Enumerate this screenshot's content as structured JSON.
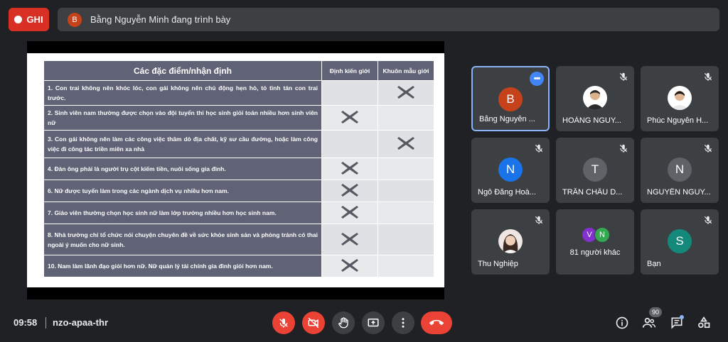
{
  "top_bar": {
    "record_label": "GHI",
    "presenter_initial": "B",
    "presenting_text": "Bằng Nguyễn Minh đang trình bày"
  },
  "slide": {
    "headers": [
      "Các đặc điểm/nhận định",
      "Định kiến giới",
      "Khuôn mẫu giới"
    ],
    "rows": [
      {
        "text": "1. Con trai không nên khóc lóc, con gái không nên chủ động hẹn hò, tỏ tình tán con trai trước.",
        "dinh_kien": false,
        "khuon_mau": true
      },
      {
        "text": "2. Sinh viên nam thường được chọn vào đội tuyển thi học sinh giỏi toán nhiều hơn sinh viên nữ",
        "dinh_kien": true,
        "khuon_mau": false
      },
      {
        "text": "3. Con gái không nên làm các công việc thăm dò địa chất, kỹ sư cầu đường, hoặc làm công việc đi công tác triền miên xa nhà",
        "dinh_kien": false,
        "khuon_mau": true
      },
      {
        "text": "4. Đàn ông phải là người trụ cột kiếm tiền, nuôi sống gia đình.",
        "dinh_kien": true,
        "khuon_mau": false
      },
      {
        "text": "6. Nữ được tuyển làm trong các ngành dịch vụ nhiều hơn nam.",
        "dinh_kien": true,
        "khuon_mau": false
      },
      {
        "text": "7. Giáo viên thường chọn học sinh nữ làm lớp trưởng nhiều hơn học sinh nam.",
        "dinh_kien": true,
        "khuon_mau": false
      },
      {
        "text": "8. Nhà trường chỉ tổ chức nói chuyện chuyên đề về sức khỏe sinh sản và phòng tránh có thai ngoài ý muốn cho nữ sinh.",
        "dinh_kien": true,
        "khuon_mau": false
      },
      {
        "text": "10. Nam làm lãnh đạo giỏi hơn nữ. Nữ quản lý tài chính gia đình giỏi hơn nam.",
        "dinh_kien": true,
        "khuon_mau": false
      }
    ]
  },
  "participants": [
    {
      "name": "Bằng Nguyễn ...",
      "initial": "B",
      "color": "#c5421b",
      "photo": false
    },
    {
      "name": "HOÀNG NGUY...",
      "initial": "",
      "color": "#ffffff",
      "photo": true
    },
    {
      "name": "Phúc Nguyễn H...",
      "initial": "",
      "color": "#ffffff",
      "photo": true
    },
    {
      "name": "Ngô Đăng Hoà...",
      "initial": "N",
      "color": "#1a73e8",
      "photo": false
    },
    {
      "name": "TRẦN CHÂU D...",
      "initial": "T",
      "color": "#5f6368",
      "photo": false
    },
    {
      "name": "NGUYÊN NGUY...",
      "initial": "N",
      "color": "#5f6368",
      "photo": false
    },
    {
      "name": "Thu Nghiệp",
      "initial": "",
      "color": "#f1e6e6",
      "photo": true
    },
    {
      "name": "Bạn",
      "initial": "S",
      "color": "#12897a",
      "photo": false
    }
  ],
  "others_tile": {
    "label": "81 người khác",
    "avatars": [
      {
        "initial": "V",
        "color": "#8430ce"
      },
      {
        "initial": "N",
        "color": "#34a853"
      }
    ]
  },
  "bottom_bar": {
    "time": "09:58",
    "meeting_code": "nzo-apaa-thr",
    "participant_count": "90"
  }
}
